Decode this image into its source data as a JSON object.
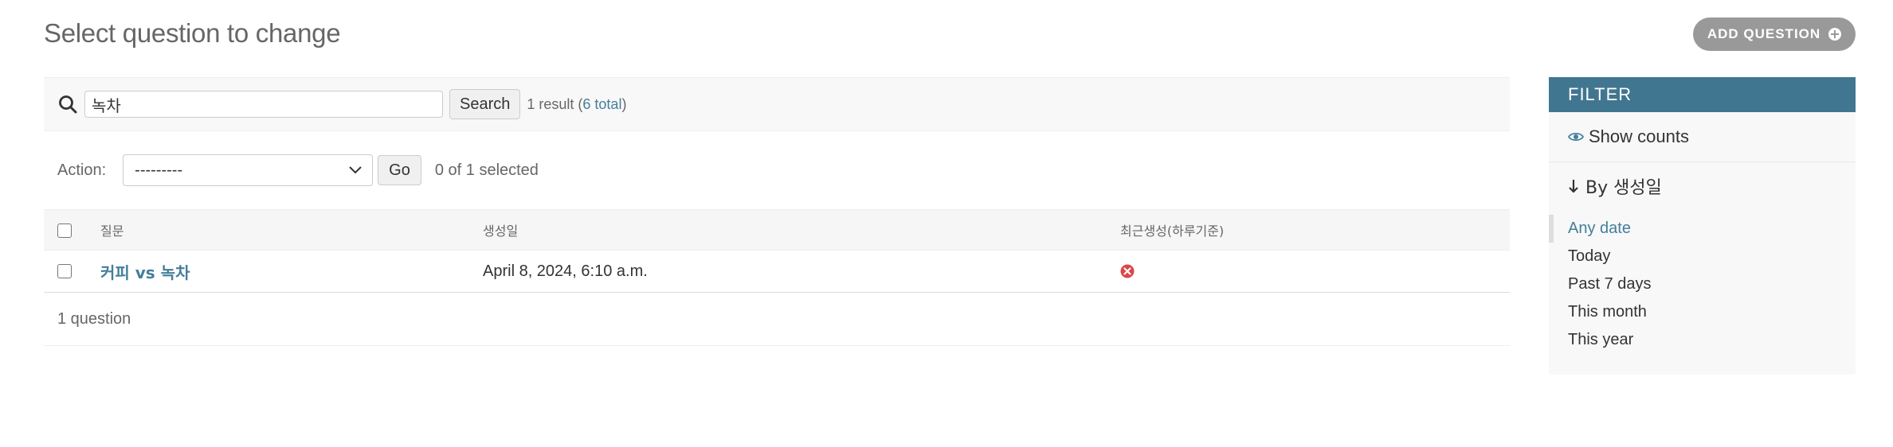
{
  "page": {
    "title": "Select question to change",
    "add_button_label": "ADD QUESTION"
  },
  "search": {
    "value": "녹차",
    "button_label": "Search",
    "result_text": "1 result (",
    "total_link": "6 total",
    "result_close": ")"
  },
  "actions": {
    "label": "Action:",
    "selected_option": "---------",
    "go_label": "Go",
    "selected_count": "0 of 1 selected"
  },
  "table": {
    "columns": [
      "질문",
      "생성일",
      "최근생성(하루기준)"
    ],
    "rows": [
      {
        "question": "커피 vs 녹차",
        "created": "April 8, 2024, 6:10 a.m.",
        "recent": "no-icon"
      }
    ]
  },
  "paginator": {
    "text": "1 question"
  },
  "filter": {
    "header": "FILTER",
    "show_counts": "Show counts",
    "section_title": "By 생성일",
    "options": [
      "Any date",
      "Today",
      "Past 7 days",
      "This month",
      "This year"
    ],
    "selected_index": 0
  },
  "colors": {
    "accent": "#417690",
    "link": "#447e9b",
    "button_gray": "#999999",
    "error_red": "#dd4646"
  }
}
